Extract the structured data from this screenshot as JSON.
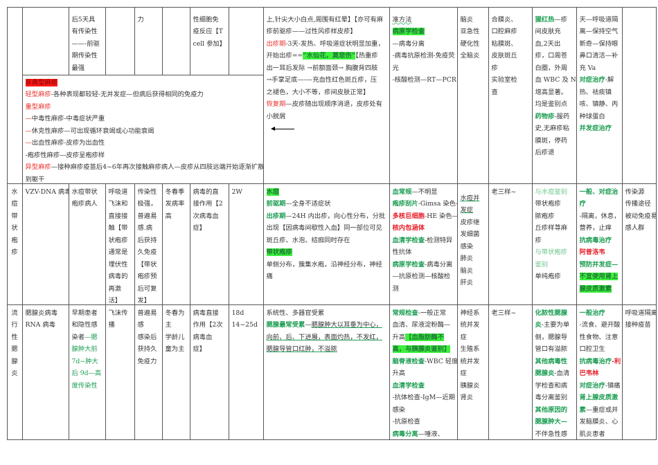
{
  "colors": {
    "green": "#1e9e54",
    "red": "#e8302a",
    "highlight_green": "#3cf03c",
    "highlight_red": "#ff1a1a"
  },
  "cells": {
    "a2": [
      "后5天具",
      "有传染性",
      "——-前驱",
      "期传染性",
      "最强"
    ],
    "a4": [
      "力"
    ],
    "a6": [
      "性细胞免",
      "疫反应【T",
      "cell 参加】"
    ],
    "blk": [
      [
        [
          "非典型麻疹",
          "hlr"
        ]
      ],
      [
        [
          "轻型麻疹",
          "red"
        ],
        "-各种表现都较轻-无并发症—但病后获得相同的免疫力"
      ],
      [
        [
          "重型麻疹",
          "red"
        ]
      ],
      [
        [
          "—",
          "red"
        ],
        "中毒性麻疹-中毒症状严重"
      ],
      [
        [
          "—",
          "red"
        ],
        "休克性麻疹—可出现循环衰竭或心功能衰竭"
      ],
      [
        [
          "—",
          "red"
        ],
        "出血性麻疹-皮疹为出血性"
      ],
      "-疱疹性麻疹—皮疹呈疱疹样",
      [
        [
          "异型麻疹",
          "red"
        ],
        "—接种麻疹疫苗后4~6年再次接触麻疹病人—皮疹从四肢远端开始逐渐扩散"
      ],
      "到躯干"
    ],
    "a8": [
      "上,针尖大小白点,周围有红晕】【亦可有麻",
      "疹前驱疹——过性风疹样皮疹】",
      [
        [
          "出疹期",
          "red"
        ],
        "-3天-发热、呼吸道症状明显加重，"
      ],
      [
        "开始出疹==",
        [
          "“水仙花，莫悲伤”",
          "hlg"
        ],
        "【热重疹"
      ],
      "出一耳后发际 →前额面颈→ 胸腹背四肢",
      "→手掌足底—-—充血性红色斑丘疹，压",
      "之褪色，大小不等，疹间皮肤正常】",
      [
        [
          "恢复期",
          "red"
        ],
        "—皮疹随出现顺序消退，皮疹处有"
      ],
      "小脱屑"
    ],
    "a9": [
      [
        [
          "准方法",
          "wavy"
        ]
      ],
      [
        [
          "病原学检查",
          "hlg"
        ]
      ],
      "—病毒分离",
      "-病毒抗原检测-免疫荧",
      "光",
      "-核酸检测—RT—PCR"
    ],
    "a10": [
      "脑炎",
      "亚急性",
      "硬化性",
      "全脑炎"
    ],
    "a11": [
      "合膜炎、",
      "口腔麻疹",
      "粘膜斑、",
      "皮肤斑丘",
      "疹",
      "实验室检",
      "查"
    ],
    "a12": [
      [
        [
          "猩红热",
          "greenb"
        ],
        "—疹"
      ],
      "间皮肤充",
      "血,2天出",
      "疹，口周苍",
      "白圈，外周",
      "血 WBC 及 NE",
      "增高显著。",
      "均是鉴别点",
      [
        [
          "药物疹",
          "greenb"
        ],
        "-服药"
      ],
      "史,无麻疹粘",
      "膜斑，停药",
      "后疹退"
    ],
    "a13": [
      "天—呼吸道隔",
      "离—保持空气",
      "新奇—保持眼",
      "鼻口清洁—补",
      "充 Va",
      [
        [
          "对症治疗",
          "greenb"
        ],
        "-解"
      ],
      "热、祛痰镇",
      "咳、镇静、丙",
      "种球蛋白",
      [
        [
          "并发症治疗",
          "greenb"
        ]
      ]
    ],
    "b0": [
      "水",
      "痘",
      "带",
      "状",
      "疱",
      "疹"
    ],
    "b1": [
      "VZV-DNA 病毒"
    ],
    "b2": [
      "水痘带状",
      "疱疹病人"
    ],
    "b3": [
      "呼吸道",
      "飞沫和",
      "直接接",
      "触【带",
      "状疱疹",
      "通常是",
      "埋伏性",
      "病毒的",
      "再激",
      "活】"
    ],
    "b4": [
      "传染性",
      "极强，",
      "普遍易",
      "感.病",
      "后获持",
      "久免疫",
      "【带状",
      "疱疹预",
      "后可复",
      "发】"
    ],
    "b5": [
      "冬春季",
      "发病率",
      "高"
    ],
    "b6": [
      "病毒的直",
      "接作用【2",
      "次病毒血",
      "症】"
    ],
    "b7": [
      "2W"
    ],
    "b8": [
      [
        [
          "水痘",
          "hlg"
        ]
      ],
      [
        [
          "前驱期",
          "greenb"
        ],
        "—全身不适症状"
      ],
      [
        [
          "出疹期",
          "greenb"
        ],
        "—24H 内出疹，向心性分布，分批"
      ],
      "出现【因病毒间歇性入血】同一部位可见",
      "斑丘疹、水泡、结痂同时存在",
      [
        [
          "带状疱疹",
          "hlg"
        ]
      ],
      "单侧分布，簇集水疱，沿神经分布，神经",
      "痛"
    ],
    "b9": [
      [
        [
          "血常规",
          "greenb"
        ],
        "—不明显"
      ],
      [
        [
          "疱疹刮片",
          "greenb"
        ],
        "-Gimsa 染色-"
      ],
      [
        [
          "多核巨细胞",
          "redb"
        ],
        "-HE 染色—"
      ],
      [
        [
          "核内包涵体",
          "redb"
        ]
      ],
      [
        [
          "血清学检查",
          "greenb"
        ],
        "-检测特异"
      ],
      "性抗体",
      [
        [
          "病原学检查",
          "greenb"
        ],
        "-病毒分离"
      ],
      "—抗原检测—核酸检",
      "测"
    ],
    "b10": [
      [
        [
          "水痘并",
          "ul"
        ]
      ],
      [
        [
          "发症",
          "ul"
        ]
      ],
      "皮疹继",
      "发细菌",
      "感染",
      "肺炎",
      "脑炎",
      "肝炎"
    ],
    "b11": [
      "老三样~"
    ],
    "b12": [
      [
        [
          "与水痘鉴别",
          "lgreen"
        ]
      ],
      "带状疱疹",
      "脓疱疹",
      "丘疹样荨麻",
      "疹",
      [
        [
          "与带状疱疹",
          "lgreen"
        ]
      ],
      [
        [
          "鉴别",
          "lgreen"
        ]
      ],
      "单纯疱疹"
    ],
    "b13": [
      [
        [
          "一般、对症治",
          "greenb"
        ]
      ],
      [
        [
          "疗",
          "greenb"
        ]
      ],
      "-隔离，休息，",
      "营养，止痒",
      [
        [
          "抗病毒治疗",
          "greenb"
        ]
      ],
      [
        [
          "阿昔洛韦",
          "redb"
        ]
      ],
      [
        [
          "预防并发症—",
          "greenb"
        ]
      ],
      [
        [
          "不宜使用肾上",
          "hlg"
        ]
      ],
      [
        [
          "腺皮质激素",
          "hlg"
        ]
      ]
    ],
    "b14": [
      "传染源",
      "传播途径",
      "被动免疫易",
      "感人群"
    ],
    "c0": [
      "流",
      "行",
      "性",
      "腮",
      "腺",
      "炎"
    ],
    "c1": [
      "腮腺炎病毒",
      "RNA 病毒"
    ],
    "c2": [
      "早期患者",
      "和隐性感",
      [
        "染者",
        [
          "—腮",
          "green"
        ]
      ],
      [
        [
          "腺肿大前",
          "green"
        ]
      ],
      [
        [
          "7d~肿大",
          "green"
        ]
      ],
      [
        [
          "后 9d—高",
          "green"
        ]
      ],
      [
        [
          "度传染性",
          "green"
        ]
      ]
    ],
    "c3": [
      "飞沫传",
      "播"
    ],
    "c4": [
      "普遍易",
      "感",
      "感染后",
      "获持久",
      "免疫力"
    ],
    "c5": [
      "冬春为",
      "主",
      "学龄儿",
      "童为主"
    ],
    "c6": [
      "病毒直接",
      "作用【2次",
      "病毒血",
      "症】"
    ],
    "c7": [
      "18d",
      "14~25d"
    ],
    "c8": [
      "系统性、多器官受累",
      [
        [
          "腮腺最常受累",
          "greenb"
        ],
        "—",
        [
          "腮腺肿大以耳垂为中心，",
          "ul"
        ]
      ],
      [
        [
          "向前、后、下进展，表面灼热，不发红，",
          "ul"
        ]
      ],
      [
        [
          "腮腺导管口红肿，不溢脓",
          "ul"
        ]
      ]
    ],
    "c9": [
      [
        [
          "常规检查",
          "greenb"
        ],
        "-一般正常"
      ],
      "血清、尿液淀粉酶—",
      [
        "升高",
        [
          "【血脂肪酶不",
          "hlg"
        ]
      ],
      [
        [
          "高，与胰腺炎鉴别】",
          "hlg"
        ]
      ],
      [
        [
          "脑脊液检查",
          "greenb"
        ],
        "-WBC 轻度"
      ],
      "升高",
      [
        [
          "血清学检查",
          "greenb"
        ]
      ],
      "-抗体检查-IgM—近期",
      "感染",
      "-抗原检查",
      [
        [
          "病毒分离",
          "greenb"
        ],
        "—唾液、"
      ]
    ],
    "c10": [
      "神经系",
      "统并发",
      "症",
      "生殖系",
      "统并发",
      "症",
      "胰腺炎",
      "肾炎"
    ],
    "c11": [
      "老三样~"
    ],
    "c12": [
      [
        [
          "化脓性腮腺",
          "greenb"
        ]
      ],
      [
        [
          "炎",
          "greenb"
        ],
        "-主要为单"
      ],
      "侧，腮腺导",
      "管口有溢脓",
      [
        [
          "其他病毒性",
          "greenb"
        ]
      ],
      [
        [
          "腮腺炎",
          "greenb"
        ],
        "-血清"
      ],
      "学检查和病",
      "毒分离鉴别",
      [
        [
          "其他原因的",
          "greenb"
        ]
      ],
      [
        [
          "腮腺肿大—",
          "greenb"
        ]
      ],
      "不伴急性感"
    ],
    "c13": [
      [
        [
          "一般治疗",
          "greenb"
        ]
      ],
      "-流食、避开酸",
      "性食物、注意",
      "口腔卫生",
      [
        [
          "抗病毒治疗",
          "greenb"
        ],
        [
          "-利",
          "redb"
        ]
      ],
      [
        [
          "巴韦林",
          "redb"
        ]
      ],
      [
        [
          "对症治疗",
          "greenb"
        ],
        "-镇痛"
      ],
      [
        [
          "肾上腺皮质激",
          "greenb"
        ]
      ],
      [
        [
          "素",
          "greenb"
        ],
        "—重症或并"
      ],
      "发脑膜炎、心",
      "肌炎患者"
    ],
    "c14": [
      "呼吸道隔离",
      "接种疫苗"
    ]
  }
}
